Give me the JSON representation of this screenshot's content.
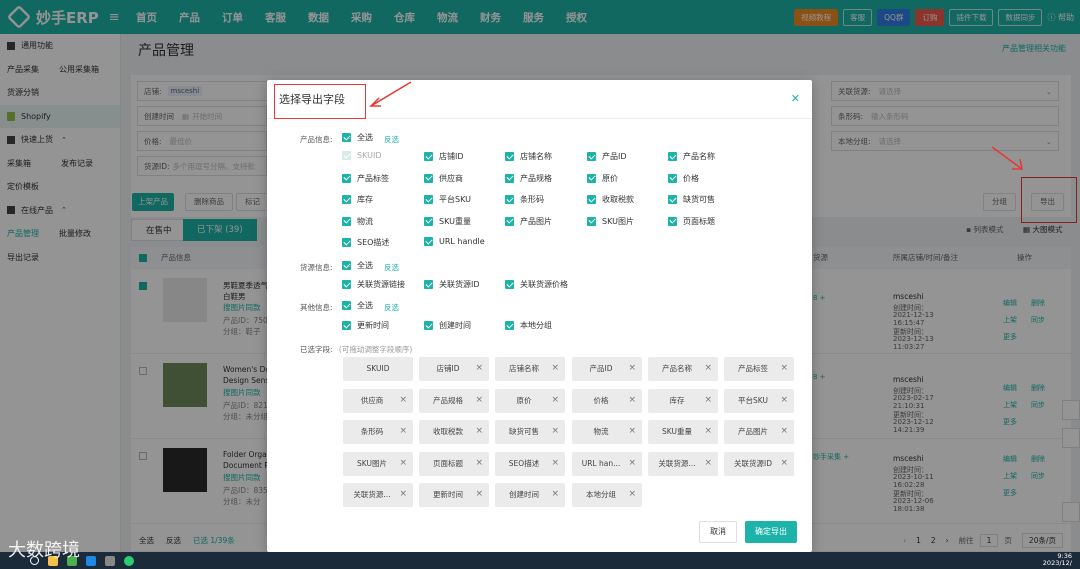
{
  "app": {
    "logo_text": "妙手ERP",
    "menu_icon": "hamburger-icon",
    "nav": [
      "首页",
      "产品",
      "订单",
      "客服",
      "数据",
      "采购",
      "仓库",
      "物流",
      "财务",
      "服务",
      "授权"
    ],
    "top_buttons": {
      "video_tutorial": "视频教程",
      "service": "客服",
      "qq_group": "QQ群",
      "subscribe": "订购",
      "plugin_download": "插件下载",
      "data_sync": "数据同步",
      "help": "帮助"
    }
  },
  "sidebar": {
    "items": [
      {
        "c1": "通用功能",
        "c2": "",
        "icon": "grid-icon"
      },
      {
        "c1": "产品采集",
        "c2": "公用采集箱"
      },
      {
        "c1": "货源分销",
        "c2": ""
      },
      {
        "c1": "Shopify",
        "c2": "",
        "icon": "shopify-icon"
      },
      {
        "c1": "快速上货",
        "c2": "",
        "icon": "grid-icon"
      },
      {
        "c1": "采集箱",
        "c2": "发布记录"
      },
      {
        "c1": "定价模板",
        "c2": ""
      },
      {
        "c1": "在线产品",
        "c2": "",
        "icon": "grid-icon"
      },
      {
        "c1": "产品管理",
        "c2": "批量修改"
      },
      {
        "c1": "导出记录",
        "c2": ""
      }
    ]
  },
  "main": {
    "title": "产品管理",
    "help_link": "产品管理相关功能",
    "filters": {
      "store_label": "店铺:",
      "store_value": "msceshi",
      "created_label": "创建时间",
      "start_time": "开始时间",
      "price_label": "价格:",
      "price_min": "最低价",
      "source_id_label": "货源ID:",
      "source_id_placeholder": "多个用逗号分隔，支持批",
      "related_source_label": "关联货源:",
      "related_source_placeholder": "请选择",
      "sku_label": "条形码:",
      "sku_placeholder": "输入条形码",
      "local_group_label": "本地分组:",
      "local_group_placeholder": "请选择"
    },
    "actions": {
      "upload": "上架产品",
      "delete": "删除商品",
      "tag": "标记"
    },
    "tabs": {
      "on_sale": "在售中",
      "off_shelf": "已下架 (39)"
    },
    "group_btn": "分组",
    "export_btn": "导出",
    "view_list": "列表模式",
    "view_grid": "大图模式",
    "table": {
      "headers": {
        "product_info": "产品信息",
        "source": "货源",
        "store_time": "所属店铺/时间/备注",
        "ops": "操作"
      },
      "rows": [
        {
          "title1": "男鞋夏季透气白",
          "title2": "白鞋男",
          "img_search": "搜图片同款",
          "pid": "产品ID：7508",
          "group": "分组：鞋子",
          "store": "msceshi",
          "created_label": "创建时间：",
          "created": "2021-12-13",
          "created_time": "16:15:47",
          "updated_label": "更新时间：",
          "updated": "2023-12-13",
          "updated_time": "11:03:27",
          "source_count": "8 +"
        },
        {
          "title1": "Women's Doll",
          "title2": "Design Sense",
          "img_search": "搜图片同款",
          "pid": "产品ID：8215",
          "group": "分组：未分组",
          "store": "msceshi",
          "created_label": "创建时间：",
          "created": "2023-02-17",
          "created_time": "21:10:31",
          "updated_label": "更新时间：",
          "updated": "2023-12-12",
          "updated_time": "14:21:39",
          "source_count": "8 +"
        },
        {
          "title1": "Folder Organi",
          "title2": "Document Pla",
          "img_search": "搜图片同款",
          "pid": "产品ID：8356",
          "group": "分组：未分",
          "store": "msceshi",
          "created_label": "创建时间：",
          "created": "2023-10-11",
          "created_time": "16:02:28",
          "updated_label": "更新时间：",
          "updated": "2023-12-06",
          "updated_time": "18:01:38",
          "source_count": "妙手采集 +"
        }
      ],
      "ops": {
        "edit": "编辑",
        "delete": "删除",
        "list": "上架",
        "sync": "同步",
        "more": "更多"
      }
    },
    "bottom": {
      "select_all": "全选",
      "invert": "反选",
      "selected": "已选 1/39条",
      "prev": "‹",
      "page1": "1",
      "page2": "2",
      "next": "›",
      "goto": "前往",
      "page_input": "1",
      "page_unit": "页",
      "page_size": "20条/页"
    }
  },
  "modal": {
    "title": "选择导出字段",
    "close_icon": "close-icon",
    "product_label": "产品信息:",
    "select_all": "全选",
    "invert": "反选",
    "product_fields": [
      "SKUID",
      "店铺ID",
      "店铺名称",
      "产品ID",
      "产品名称",
      "产品标签",
      "供应商",
      "产品规格",
      "原价",
      "价格",
      "库存",
      "平台SKU",
      "条形码",
      "收取税款",
      "缺货可售",
      "物流",
      "SKU重量",
      "产品图片",
      "SKU图片",
      "页面标题",
      "SEO描述",
      "URL handle"
    ],
    "source_label": "货源信息:",
    "source_fields": [
      "关联货源链接",
      "关联货源ID",
      "关联货源价格"
    ],
    "other_label": "其他信息:",
    "other_fields": [
      "更新时间",
      "创建时间",
      "本地分组"
    ],
    "selected_label": "已选字段:",
    "selected_hint": "(可拖动调整字段顺序)",
    "selected_chips": [
      "SKUID",
      "店铺ID",
      "店铺名称",
      "产品ID",
      "产品名称",
      "产品标签",
      "供应商",
      "产品规格",
      "原价",
      "价格",
      "库存",
      "平台SKU",
      "条形码",
      "收取税款",
      "缺货可售",
      "物流",
      "SKU重量",
      "产品图片",
      "SKU图片",
      "页面标题",
      "SEO描述",
      "URL han...",
      "关联货源...",
      "关联货源ID",
      "关联货源...",
      "更新时间",
      "创建时间",
      "本地分组"
    ],
    "cancel": "取消",
    "confirm": "确定导出"
  },
  "taskbar": {
    "time": "9:36",
    "date": "2023/12/"
  },
  "watermark": "大数跨境",
  "colors": {
    "accent": "#1eb3a8",
    "annotation": "#e53935"
  }
}
